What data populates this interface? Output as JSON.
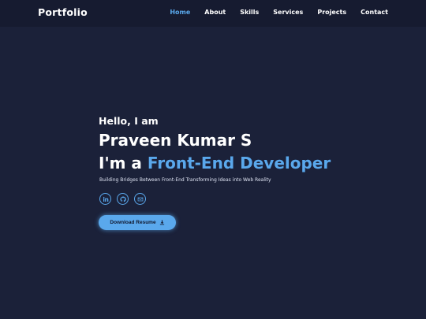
{
  "header": {
    "brand": "Portfolio",
    "nav": [
      {
        "label": "Home",
        "active": true
      },
      {
        "label": "About",
        "active": false
      },
      {
        "label": "Skills",
        "active": false
      },
      {
        "label": "Services",
        "active": false
      },
      {
        "label": "Projects",
        "active": false
      },
      {
        "label": "Contact",
        "active": false
      }
    ]
  },
  "hero": {
    "greeting": "Hello, I am",
    "name": "Praveen Kumar S",
    "role_prefix": "I'm a",
    "role_highlight": "Front-End Developer",
    "tagline": "Building Bridges Between Front-End Transforming Ideas into Web Reality",
    "socials": [
      "linkedin-icon",
      "github-icon",
      "email-icon"
    ],
    "resume_button": "Download Resume"
  },
  "colors": {
    "background": "#1b2139",
    "navbar": "#161b30",
    "accent": "#5aa8ec",
    "text": "#ffffff"
  }
}
